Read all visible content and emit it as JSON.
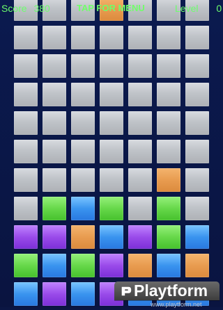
{
  "hud": {
    "score_label": "Score",
    "score_value": "380",
    "menu_label": "TAP FOR MENU",
    "level_label": "Level",
    "level_value": "0"
  },
  "board": {
    "rows": [
      [
        "gray",
        "gray",
        "gray",
        "orange",
        "gray",
        "gray",
        "gray"
      ],
      [
        "gray",
        "gray",
        "gray",
        "gray",
        "gray",
        "gray",
        "gray"
      ],
      [
        "gray",
        "gray",
        "gray",
        "gray",
        "gray",
        "gray",
        "gray"
      ],
      [
        "gray",
        "gray",
        "gray",
        "gray",
        "gray",
        "gray",
        "gray"
      ],
      [
        "gray",
        "gray",
        "gray",
        "gray",
        "gray",
        "gray",
        "gray"
      ],
      [
        "gray",
        "gray",
        "gray",
        "gray",
        "gray",
        "gray",
        "gray"
      ],
      [
        "gray",
        "gray",
        "gray",
        "gray",
        "gray",
        "orange",
        "gray"
      ],
      [
        "gray",
        "green",
        "blue",
        "green",
        "gray",
        "green",
        "gray"
      ],
      [
        "purple",
        "purple",
        "orange",
        "blue",
        "purple",
        "green",
        "blue"
      ],
      [
        "green",
        "blue",
        "green",
        "purple",
        "orange",
        "blue",
        "orange"
      ],
      [
        "blue",
        "purple",
        "blue",
        "purple",
        "blue",
        "blue",
        "blue"
      ]
    ]
  },
  "colors": {
    "gray": "#c4c8cd",
    "orange": "#e89c50",
    "green": "#67d84a",
    "blue": "#3a94ef",
    "purple": "#9a4bea",
    "hud_text": "#6dff6d",
    "background": "#0b1644"
  },
  "watermark": {
    "logo_icon": "playtform-logo-icon",
    "brand_text": "Playtform",
    "url_text": "www.playtform.net"
  }
}
